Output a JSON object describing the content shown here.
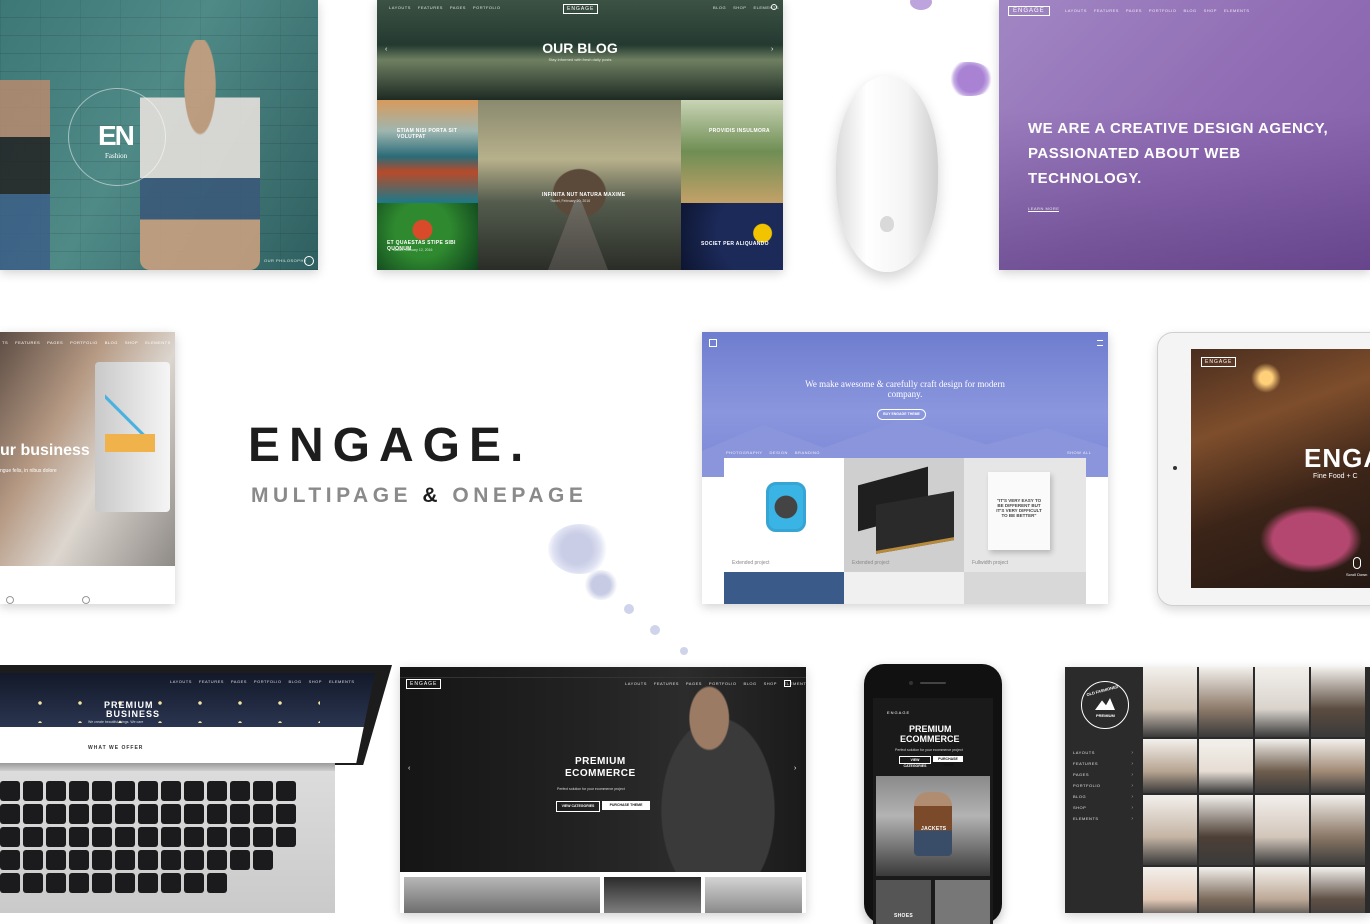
{
  "hero": {
    "title": "ENGAGE.",
    "subtitle_left": "MULTIPAGE",
    "subtitle_amp": "&",
    "subtitle_right": "ONEPAGE"
  },
  "fashion": {
    "logo_mark": "EN",
    "logo_sub": "Fashion",
    "philosophy": "OUR PHILOSOPHY"
  },
  "blog": {
    "logo": "ENGAGE",
    "nav_left": [
      "LAYOUTS",
      "FEATURES",
      "PAGES",
      "PORTFOLIO"
    ],
    "nav_right": [
      "BLOG",
      "SHOP",
      "ELEMENTS"
    ],
    "title": "OUR BLOG",
    "tagline": "Stay informed with fresh daily posts",
    "posts": [
      {
        "title": "ETIAM NISI PORTA SIT VOLUTPAT"
      },
      {
        "title": "INFINITA NUT NATURA MAXIME",
        "date": "Travel, February 20, 2016"
      },
      {
        "title": "PROVIDIS INSULMORA"
      },
      {
        "title": "ET QUAESTAS STIPE SIBI QUONUM",
        "date": "Nature, January 12, 2016"
      },
      {
        "title": "SOCIET PER ALIQUANDO"
      }
    ]
  },
  "agency": {
    "logo": "ENGAGE",
    "nav": [
      "LAYOUTS",
      "FEATURES",
      "PAGES",
      "PORTFOLIO",
      "BLOG",
      "SHOP",
      "ELEMENTS"
    ],
    "headline_1": "WE ARE A CREATIVE DESIGN AGENCY,",
    "headline_2": "PASSIONATED ABOUT WEB",
    "headline_3": "TECHNOLOGY.",
    "link": "LEARN MORE"
  },
  "business": {
    "nav": [
      "TS",
      "FEATURES",
      "PAGES",
      "PORTFOLIO",
      "BLOG",
      "SHOP",
      "ELEMENTS"
    ],
    "headline": "ur business",
    "sub": "ngue felis, in nibus dolore"
  },
  "portfolio": {
    "headline_1": "We make awesome & carefully craft design for modern",
    "headline_2": "company.",
    "button": "BUY ENGAGE THEME",
    "filters": [
      "PHOTOGRAPHY",
      "DESIGN",
      "BRANDING"
    ],
    "filter_right": "SHOW ALL",
    "items": [
      {
        "caption": "Extended project"
      },
      {
        "caption": "Extended project"
      },
      {
        "caption": "Fullwidth project"
      }
    ],
    "quote": "\"IT'S VERY EASY TO BE DIFFERENT BUT IT'S VERY DIFFICULT TO BE BETTER\""
  },
  "tablet": {
    "logo": "ENGAGE",
    "headline": "ENGA",
    "sub": "Fine Food + C",
    "scroll": "Scroll Down"
  },
  "laptop": {
    "headline_1": "PREMIUM",
    "headline_2": "BUSINESS",
    "sub": "We create beautiful things. We care",
    "offer": "WHAT WE OFFER",
    "nav": [
      "LAYOUTS",
      "FEATURES",
      "PAGES",
      "PORTFOLIO",
      "BLOG",
      "SHOP",
      "ELEMENTS"
    ]
  },
  "ecommerce": {
    "logo": "ENGAGE",
    "nav": [
      "LAYOUTS",
      "FEATURES",
      "PAGES",
      "PORTFOLIO",
      "BLOG",
      "SHOP",
      "ELEMENTS"
    ],
    "headline_1": "PREMIUM",
    "headline_2": "ECOMMERCE",
    "sub": "Perfect solution for your ecommerce project",
    "btn_1": "VIEW CATEGORIES",
    "btn_2": "PURCHASE THEME"
  },
  "phone": {
    "logo": "ENGAGE",
    "headline_1": "PREMIUM",
    "headline_2": "ECOMMERCE",
    "sub": "Perfect solution for your ecommerce project",
    "btn_1": "View Categories",
    "btn_2": "Purchase Theme",
    "tag": "JACKETS",
    "tag2": "SHOES"
  },
  "oldfashioned": {
    "badge_1": "OLD FASHIONED",
    "badge_2": "PREMIUM",
    "nav": [
      "LAYOUTS",
      "FEATURES",
      "PAGES",
      "PORTFOLIO",
      "BLOG",
      "SHOP",
      "ELEMENTS"
    ]
  },
  "colors": {
    "title": "#1d1d1d",
    "subtitle": "#8a8a8a",
    "agency_purple": "#8d6ab0",
    "portfolio_blue": "#7b87d6",
    "dark_sidebar": "#2b2b2b"
  }
}
